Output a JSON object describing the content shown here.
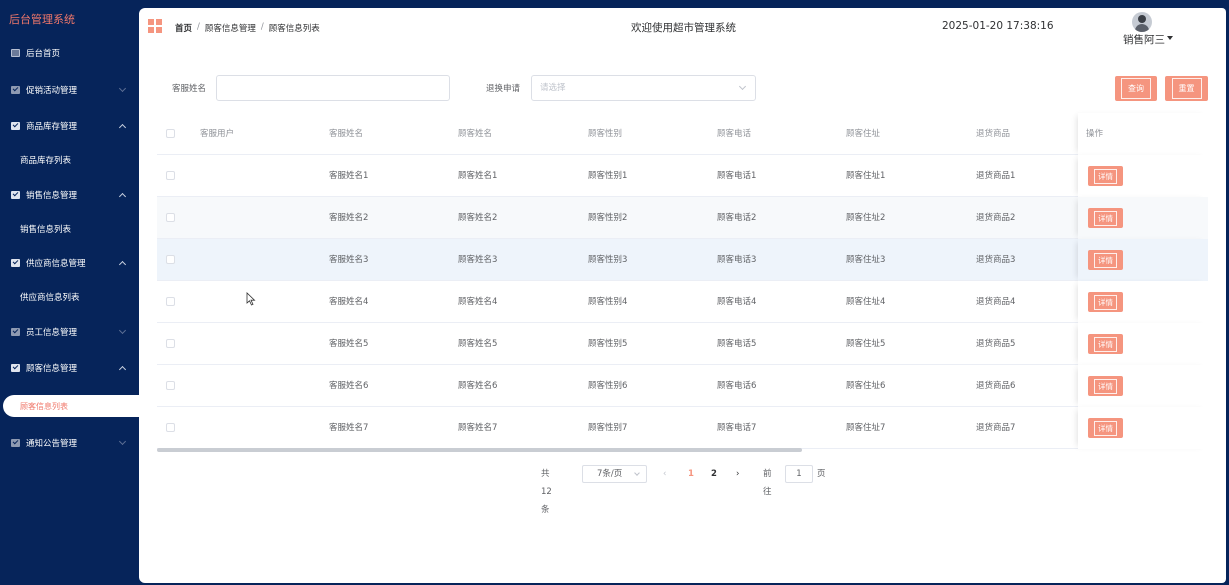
{
  "sidebar": {
    "brand": "后台管理系统",
    "items": [
      {
        "label": "后台首页"
      },
      {
        "label": "促销活动管理"
      },
      {
        "label": "商品库存管理"
      },
      {
        "label": "商品库存列表"
      },
      {
        "label": "销售信息管理"
      },
      {
        "label": "销售信息列表"
      },
      {
        "label": "供应商信息管理"
      },
      {
        "label": "供应商信息列表"
      },
      {
        "label": "员工信息管理"
      },
      {
        "label": "顾客信息管理"
      },
      {
        "label": "顾客信息列表"
      },
      {
        "label": "通知公告管理"
      }
    ]
  },
  "header": {
    "breadcrumb": [
      "首页",
      "/",
      "顾客信息管理",
      "/",
      "顾客信息列表"
    ],
    "welcome": "欢迎使用超市管理系统",
    "datetime": "2025-01-20 17:38:16",
    "username": "销售阿三"
  },
  "search": {
    "name_label": "客服姓名",
    "name_value": "",
    "refund_label": "退换申请",
    "refund_placeholder": "请选择",
    "query_button": "查询",
    "reset_button": "重置"
  },
  "table": {
    "columns": [
      "客服用户",
      "客服姓名",
      "顾客姓名",
      "顾客性别",
      "顾客电话",
      "顾客住址",
      "退货商品",
      "操作"
    ],
    "rows": [
      {
        "kefuyonghu": "",
        "kefuxingming": "客服姓名1",
        "guke": "顾客姓名1",
        "xingbie": "顾客性别1",
        "dianhua": "顾客电话1",
        "zhuzhi": "顾客住址1",
        "shangpin": "退货商品1"
      },
      {
        "kefuyonghu": "",
        "kefuxingming": "客服姓名2",
        "guke": "顾客姓名2",
        "xingbie": "顾客性别2",
        "dianhua": "顾客电话2",
        "zhuzhi": "顾客住址2",
        "shangpin": "退货商品2"
      },
      {
        "kefuyonghu": "",
        "kefuxingming": "客服姓名3",
        "guke": "顾客姓名3",
        "xingbie": "顾客性别3",
        "dianhua": "顾客电话3",
        "zhuzhi": "顾客住址3",
        "shangpin": "退货商品3"
      },
      {
        "kefuyonghu": "",
        "kefuxingming": "客服姓名4",
        "guke": "顾客姓名4",
        "xingbie": "顾客性别4",
        "dianhua": "顾客电话4",
        "zhuzhi": "顾客住址4",
        "shangpin": "退货商品4"
      },
      {
        "kefuyonghu": "",
        "kefuxingming": "客服姓名5",
        "guke": "顾客姓名5",
        "xingbie": "顾客性别5",
        "dianhua": "顾客电话5",
        "zhuzhi": "顾客住址5",
        "shangpin": "退货商品5"
      },
      {
        "kefuyonghu": "",
        "kefuxingming": "客服姓名6",
        "guke": "顾客姓名6",
        "xingbie": "顾客性别6",
        "dianhua": "顾客电话6",
        "zhuzhi": "顾客住址6",
        "shangpin": "退货商品6"
      },
      {
        "kefuyonghu": "",
        "kefuxingming": "客服姓名7",
        "guke": "顾客姓名7",
        "xingbie": "顾客性别7",
        "dianhua": "顾客电话7",
        "zhuzhi": "顾客住址7",
        "shangpin": "退货商品7"
      }
    ],
    "detail_button": "详情"
  },
  "pagination": {
    "total": "共 12 条",
    "page_size": "7条/页",
    "prev": "‹",
    "pages": [
      "1",
      "2"
    ],
    "next": "›",
    "goto_label": "前往",
    "goto_value": "1",
    "page_suffix": "页"
  },
  "colors": {
    "sidebar_bg": "#06245a",
    "accent": "#f5957f",
    "brand_text": "#f0776a"
  }
}
